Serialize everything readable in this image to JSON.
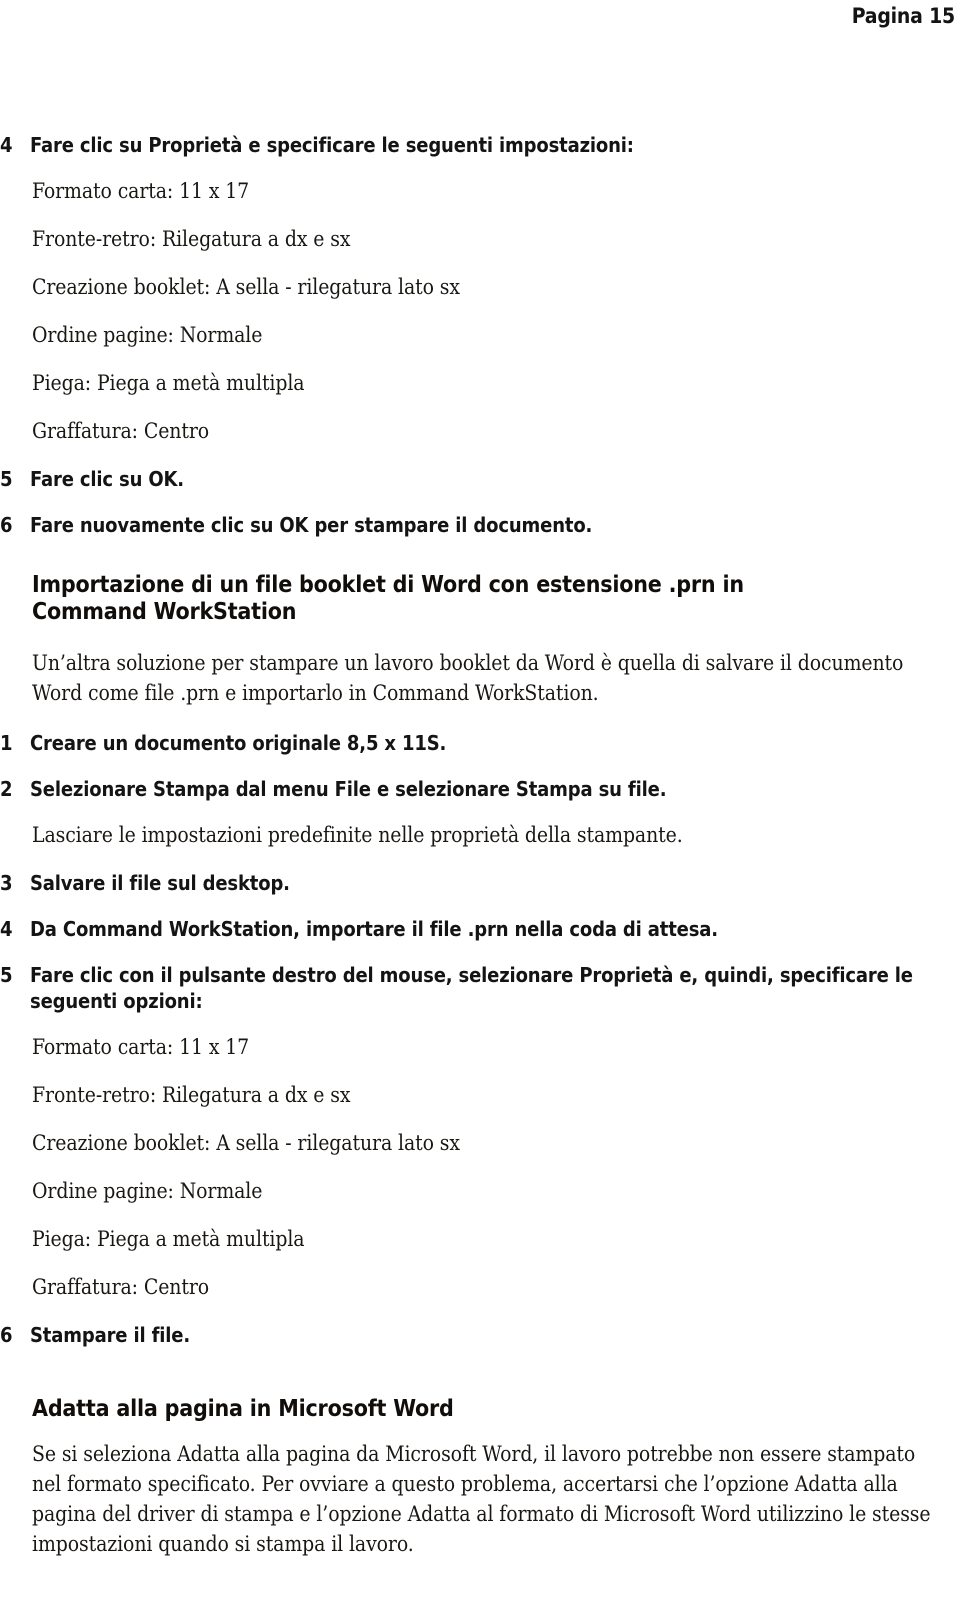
{
  "header": {
    "page_label": "Pagina 15"
  },
  "sections": [
    {
      "id": "booklet-proprieta",
      "steps": [
        {
          "num": "4",
          "text": "Fare clic su Proprietà e specificare le seguenti impostazioni:"
        }
      ],
      "settings": [
        "Formato carta: 11 x 17",
        "Fronte-retro: Rilegatura a dx e sx",
        "Creazione booklet: A sella - rilegatura lato sx",
        "Ordine pagine: Normale",
        "Piega: Piega a metà multipla",
        "Graffatura: Centro"
      ],
      "steps_after": [
        {
          "num": "5",
          "text": "Fare clic su OK."
        },
        {
          "num": "6",
          "text": "Fare nuovamente clic su OK per stampare il documento."
        }
      ]
    }
  ],
  "heading_import": "Importazione di un file booklet di Word con estensione .prn in Command WorkStation",
  "intro_paragraph": "Un’altra soluzione per stampare un lavoro booklet da Word è quella di salvare il documento Word come file .prn e importarlo in Command WorkStation.",
  "import_steps": [
    {
      "num": "1",
      "text": "Creare un documento originale 8,5 x 11S."
    },
    {
      "num": "2",
      "text": "Selezionare Stampa dal menu File e selezionare Stampa su file."
    }
  ],
  "import_note": "Lasciare le impostazioni predefinite nelle proprietà della stampante.",
  "import_steps_2": [
    {
      "num": "3",
      "text": "Salvare il file sul desktop."
    },
    {
      "num": "4",
      "text": "Da Command WorkStation, importare il file .prn nella coda di attesa."
    },
    {
      "num": "5",
      "text": "Fare clic con il pulsante destro del mouse, selezionare Proprietà e, quindi, specificare le seguenti opzioni:"
    }
  ],
  "import_settings": [
    "Formato carta: 11 x 17",
    "Fronte-retro: Rilegatura a dx e sx",
    "Creazione booklet: A sella - rilegatura lato sx",
    "Ordine pagine: Normale",
    "Piega: Piega a metà multipla",
    "Graffatura: Centro"
  ],
  "import_final_step": {
    "num": "6",
    "text": "Stampare il file."
  },
  "heading_adatta": "Adatta alla pagina in Microsoft Word",
  "adatta_paragraph": "Se si seleziona Adatta alla pagina da Microsoft Word, il lavoro potrebbe non essere stampato nel formato specificato. Per ovviare a questo problema, accertarsi che l’opzione Adatta alla pagina del driver di stampa e l’opzione Adatta al formato di Microsoft Word utilizzino le stesse impostazioni quando si stampa il lavoro."
}
